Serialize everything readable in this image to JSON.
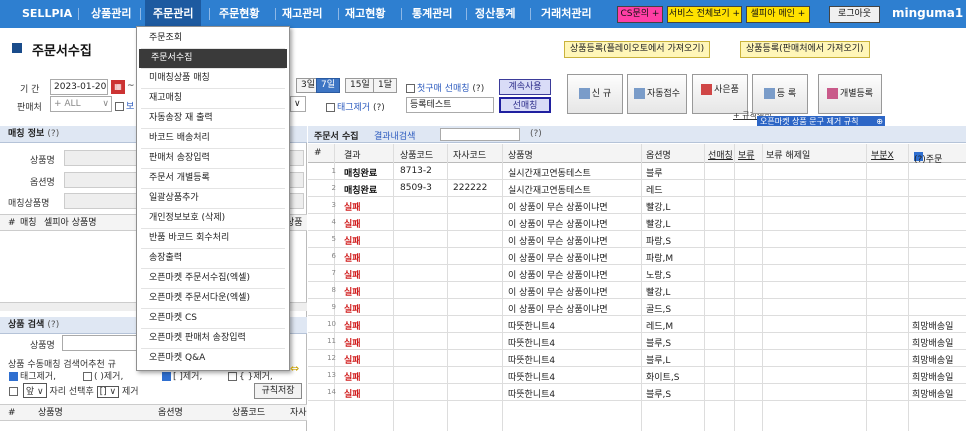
{
  "nav": {
    "items": [
      "SELLPIA",
      "상품관리",
      "주문관리",
      "주문현황",
      "재고관리",
      "재고현황",
      "통계관리",
      "정산통계",
      "거래처관리"
    ],
    "active": "주문관리",
    "cs_button": "CS문의 +",
    "service_button": "서비스 전체보기 +",
    "sellpia_main_button": "셀피아 메인 +",
    "logout_button": "로그아웃",
    "username": "minguma1"
  },
  "title": {
    "page_title": "주문서수집",
    "product_register_auto": "상품등록(플레이오토에서 가져오기)",
    "product_register_vendor": "상품등록(판매처에서 가져오기)"
  },
  "filter": {
    "period_label": "기  간",
    "date_from": "2023-01-20",
    "date_sep": "~",
    "vendor_label": "판매처",
    "vendor_value": "+ ALL",
    "view_label": "보",
    "day_buttons": [
      "3일",
      "7일",
      "15일",
      "1달"
    ],
    "day_selected": "7일",
    "first_buy_label": "첫구매 선매칭",
    "first_buy_q": "(?)",
    "tag_remove_label": "태그제거",
    "tag_remove_q": "(?)",
    "continue_label": "계속사용",
    "register_text": "등록테스트",
    "select_match_button": "선매칭",
    "btn_new": "신 규",
    "btn_auto": "자동접수",
    "btn_gift": "사은품",
    "btn_register": "등 록",
    "btn_individual": "개별등록",
    "rule_setting": "+ 규칙설정",
    "remove_bar": "오픈마켓 상품 문구 제거 규칙"
  },
  "left": {
    "match_info_title": "매칭 정보",
    "match_info_q": "(?)",
    "product_name_label": "상품명",
    "option_label": "옵션명",
    "match_product_label": "매칭상품명",
    "grid_headers": [
      "#",
      "매칭",
      "셀피아 상품명",
      "상품"
    ],
    "product_search_title": "상품 검색",
    "product_search_q": "(?)",
    "search_product_label": "상품명",
    "manual_match_label": "상품 수동매칭 검색어추천 규",
    "tag_remove": "태그제거,",
    "paren_remove": "( )제거,",
    "bracket_remove": "[ ]제거,",
    "brace_remove": "{ }제거,",
    "select_front": "앞",
    "select_position": "자리 선택후",
    "select_bracket": "[]",
    "remove_word": "제거",
    "rule_save": "규칙저장",
    "bottom_headers": [
      "#",
      "상품명",
      "옵션명",
      "상품코드",
      "자사"
    ]
  },
  "dropdown": {
    "items": [
      "주문조회",
      "주문서수집",
      "미매칭상품 매칭",
      "재고매칭",
      "자동송장 재 출력",
      "바코드 배송처리",
      "판매처 송장입력",
      "주문서 개별등록",
      "일괄상품추가",
      "개인정보보호 (삭제)",
      "반품 바코드 회수처리",
      "송장출력",
      "오픈마켓 주문서수집(엑셀)",
      "오픈마켓 주문서다운(엑셀)",
      "오픈마켓 CS",
      "오픈마켓 판매처 송장입력",
      "오픈마켓 Q&A"
    ],
    "selected_index": 1
  },
  "main": {
    "title": "주문서 수집",
    "result_search": "결과내검색",
    "result_q": "(?)",
    "headers": [
      "#",
      "결과",
      "상품코드",
      "자사코드",
      "상품명",
      "옵션명",
      "선매칭",
      "보류",
      "보류 해제일",
      "부분X",
      "(?)주문"
    ],
    "rows": [
      {
        "n": "1",
        "result": "매칭완료",
        "code": "8713-2",
        "own": "",
        "name": "실시간재고연동테스트",
        "option": "블루",
        "extra": ""
      },
      {
        "n": "2",
        "result": "매칭완료",
        "code": "8509-3",
        "own": "222222",
        "name": "실시간재고연동테스트",
        "option": "레드",
        "extra": ""
      },
      {
        "n": "3",
        "result": "실패",
        "code": "",
        "own": "",
        "name": "이 상품이 무슨 상품이냐면",
        "option": "빨강,L",
        "extra": ""
      },
      {
        "n": "4",
        "result": "실패",
        "code": "",
        "own": "",
        "name": "이 상품이 무슨 상품이냐면",
        "option": "빨강,L",
        "extra": ""
      },
      {
        "n": "5",
        "result": "실패",
        "code": "",
        "own": "",
        "name": "이 상품이 무슨 상품이냐면",
        "option": "파랑,S",
        "extra": ""
      },
      {
        "n": "6",
        "result": "실패",
        "code": "",
        "own": "",
        "name": "이 상품이 무슨 상품이냐면",
        "option": "파랑,M",
        "extra": ""
      },
      {
        "n": "7",
        "result": "실패",
        "code": "",
        "own": "",
        "name": "이 상품이 무슨 상품이냐면",
        "option": "노랑,S",
        "extra": ""
      },
      {
        "n": "8",
        "result": "실패",
        "code": "",
        "own": "",
        "name": "이 상품이 무슨 상품이냐면",
        "option": "빨강,L",
        "extra": ""
      },
      {
        "n": "9",
        "result": "실패",
        "code": "",
        "own": "",
        "name": "이 상품이 무슨 상품이냐면",
        "option": "골드,S",
        "extra": ""
      },
      {
        "n": "10",
        "result": "실패",
        "code": "",
        "own": "",
        "name": "따뜻한니트4",
        "option": "레드,M",
        "extra": "희망배송일"
      },
      {
        "n": "11",
        "result": "실패",
        "code": "",
        "own": "",
        "name": "따뜻한니트4",
        "option": "블루,S",
        "extra": "희망배송일"
      },
      {
        "n": "12",
        "result": "실패",
        "code": "",
        "own": "",
        "name": "따뜻한니트4",
        "option": "블루,L",
        "extra": "희망배송일"
      },
      {
        "n": "13",
        "result": "실패",
        "code": "",
        "own": "",
        "name": "따뜻한니트4",
        "option": "화이트,S",
        "extra": "희망배송일"
      },
      {
        "n": "14",
        "result": "실패",
        "code": "",
        "own": "",
        "name": "따뜻한니트4",
        "option": "블루,S",
        "extra": "희망배송일"
      }
    ]
  },
  "colors": {
    "nav_bg": "#2e7fd0",
    "nav_active": "#1d5aa0",
    "fail": "#d01c1c",
    "cs_btn": "#ff3ea5",
    "service_btn": "#ffe100",
    "main_btn": "#ffe100"
  }
}
